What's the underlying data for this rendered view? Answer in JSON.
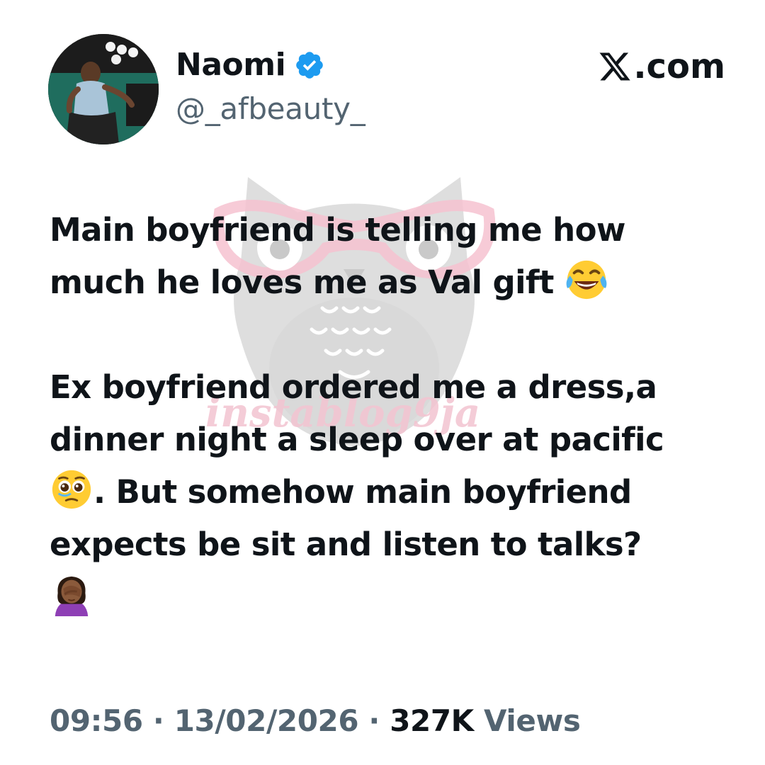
{
  "author": {
    "display_name": "Naomi",
    "handle": "@_afbeauty_",
    "verified": true,
    "avatar_icon": "profile-photo"
  },
  "brand": {
    "label": ".com",
    "logo_icon": "x-logo-icon"
  },
  "tweet": {
    "paragraph1_line1": "Main boyfriend is telling me how",
    "paragraph1_line2": "much he loves me as Val gift",
    "paragraph1_emoji": "face-with-tears-of-joy",
    "paragraph2_line1": "Ex boyfriend ordered me a dress,a",
    "paragraph2_line2": "dinner night a sleep over at pacific",
    "paragraph2_emoji1": "pleading-face",
    "paragraph2_line3": ". But somehow main boyfriend",
    "paragraph2_line4": "expects be sit and listen to talks?",
    "paragraph2_emoji2": "woman-facepalming"
  },
  "meta": {
    "time": "09:56",
    "separator1": " · ",
    "date": "13/02/2026",
    "separator2": " · ",
    "views_count": "327K",
    "views_label": " Views"
  },
  "watermark": {
    "text": "instablog9ja",
    "icon": "owl-with-glasses-icon"
  },
  "colors": {
    "text": "#0f1419",
    "secondary": "#536471",
    "verified": "#1d9bf0",
    "watermark_pink": "#f3c4d1",
    "watermark_gray": "#d9d9d9"
  }
}
